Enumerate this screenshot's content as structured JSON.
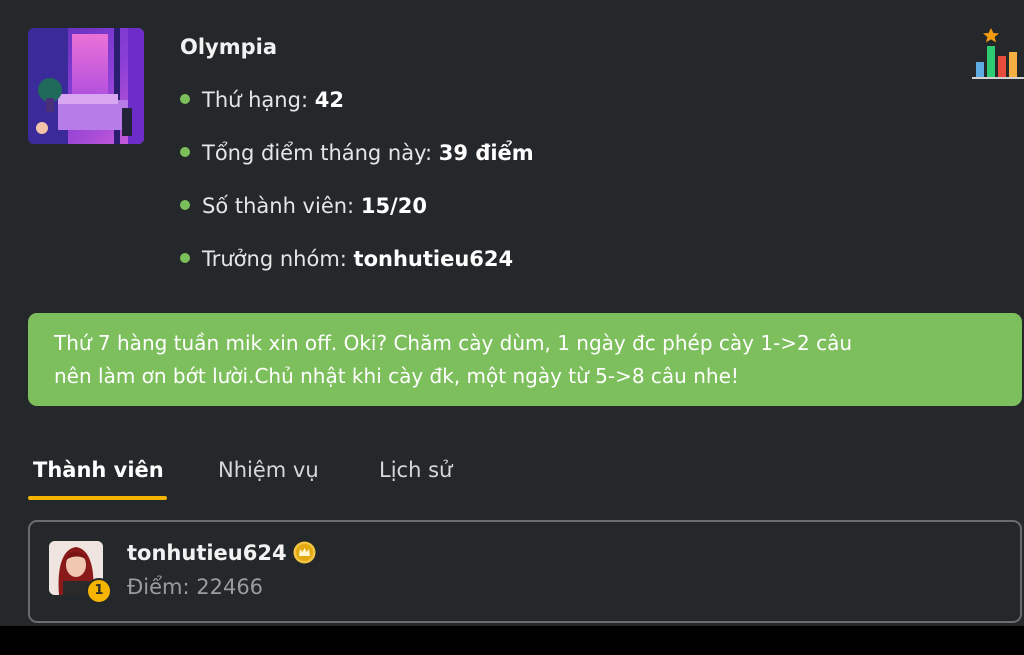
{
  "group": {
    "name": "Olympia",
    "stats": [
      {
        "label": "Thứ hạng:",
        "value": "42"
      },
      {
        "label": "Tổng điểm tháng này:",
        "value": "39 điểm"
      },
      {
        "label": "Số thành viên:",
        "value": "15/20"
      },
      {
        "label": "Trưởng nhóm:",
        "value": "tonhutieu624"
      }
    ]
  },
  "notice": {
    "lines": [
      "Thứ 7 hàng tuần mik xin off. Oki? Chăm cày dùm, 1 ngày đc phép cày 1->2 câu",
      "nên làm ơn bớt lười.Chủ nhật khi cày đk, một ngày từ 5->8 câu nhe!"
    ]
  },
  "tabs": [
    {
      "label": "Thành viên",
      "active": true
    },
    {
      "label": "Nhiệm vụ",
      "active": false
    },
    {
      "label": "Lịch sử",
      "active": false
    }
  ],
  "members": [
    {
      "name": "tonhutieu624",
      "rank": "1",
      "points": "Điểm: 22466",
      "role_icon": "crown-badge-icon"
    }
  ],
  "icons": {
    "ranking": "ranking-chart-icon",
    "bullet": "bullet-dot"
  },
  "colors": {
    "background": "#25282a",
    "accent_green": "#7dbf5d",
    "tab_underline": "#f4b400",
    "rank_badge": "#f4b400",
    "card_border": "#6a6d70"
  }
}
